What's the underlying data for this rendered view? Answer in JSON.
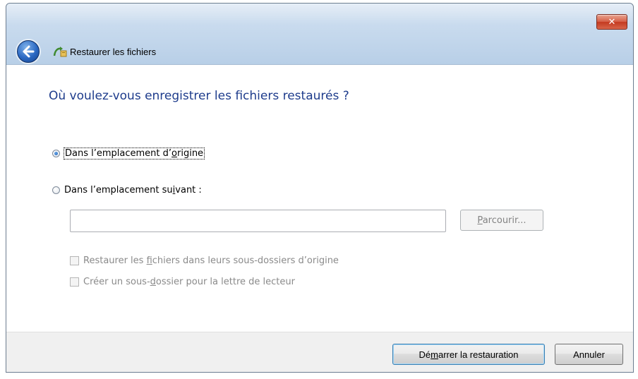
{
  "window": {
    "close_symbol": "✕",
    "nav_title": "Restaurer les fichiers",
    "back_icon": "back-arrow",
    "app_icon": "restore-files"
  },
  "main": {
    "heading": "Où voulez-vous enregistrer les fichiers restaurés ?",
    "options": [
      {
        "pre": "Dans l’emplacement d’",
        "key": "o",
        "post": "rigine",
        "checked": true
      },
      {
        "pre": "Dans l’emplacement su",
        "key": "i",
        "post": "vant :",
        "checked": false
      }
    ],
    "path_input": {
      "value": "",
      "placeholder": ""
    },
    "browse": {
      "key": "P",
      "rest": "arcourir..."
    },
    "checkboxes": [
      {
        "pre": "Restaurer les ",
        "key": "f",
        "post": "ichiers dans leurs sous-dossiers d’origine",
        "checked": false
      },
      {
        "pre": "Créer un sous-",
        "key": "d",
        "post": "ossier pour la lettre de lecteur",
        "checked": false
      }
    ]
  },
  "footer": {
    "start": {
      "pre": "Dé",
      "key": "m",
      "post": "arrer la restauration"
    },
    "cancel": "Annuler"
  },
  "colors": {
    "heading": "#1e3c8c",
    "close_button": "#c43a20",
    "titlebar": "#c9dbee"
  }
}
